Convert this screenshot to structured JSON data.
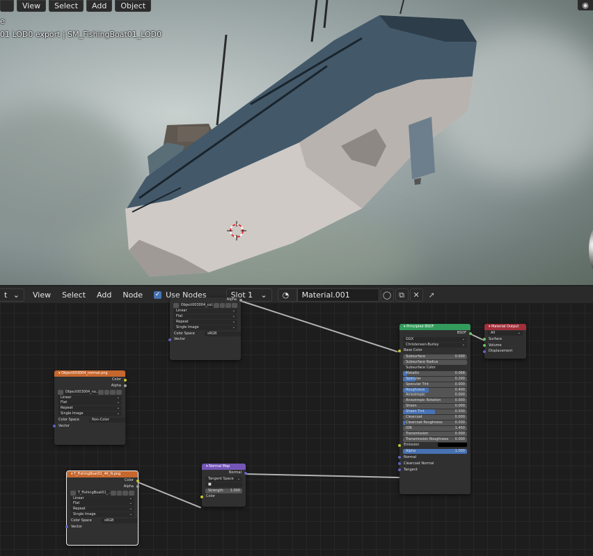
{
  "viewport": {
    "header": {
      "first_label": "",
      "view": "View",
      "select": "Select",
      "add": "Add",
      "object": "Object"
    },
    "mode_label": "e",
    "title": "01 LOD0 export | SM_FishingBoat01_LOD0"
  },
  "node_editor": {
    "header": {
      "type_label": "t",
      "view": "View",
      "select": "Select",
      "add": "Add",
      "node": "Node",
      "use_nodes": "Use Nodes",
      "slot": "Slot 1",
      "material": "Material.001"
    },
    "nodes": {
      "tex_top": {
        "alpha": "Alpha",
        "image": "Object003004_col...",
        "interp": "Linear",
        "proj": "Flat",
        "ext": "Repeat",
        "source": "Single Image",
        "cs_label": "Color Space",
        "cs_value": "sRGB",
        "vector": "Vector"
      },
      "tex_normal": {
        "title": "Object003004_normal.png",
        "color": "Color",
        "alpha": "Alpha",
        "image": "Object003004_no...",
        "interp": "Linear",
        "proj": "Flat",
        "ext": "Repeat",
        "source": "Single Image",
        "cs_label": "Color Space",
        "cs_value": "Non-Color",
        "vector": "Vector"
      },
      "tex_bottom": {
        "title": "T_FishingBoat01_4K_N.png",
        "color": "Color",
        "alpha": "Alpha",
        "image": "T_FishingBoat01_...",
        "interp": "Linear",
        "proj": "Flat",
        "ext": "Repeat",
        "source": "Single Image",
        "cs_label": "Color Space",
        "cs_value": "sRGB",
        "vector": "Vector"
      },
      "normal_map": {
        "title": "Normal Map",
        "normal": "Normal",
        "space": "Tangent Space",
        "uv": "",
        "strength_label": "Strength",
        "strength_value": "1.000",
        "color": "Color"
      },
      "principled": {
        "title": "Principled BSDF",
        "bsdf": "BSDF",
        "distribution": "GGX",
        "subsurface_method": "Christensen-Burley",
        "base_color": "Base Color",
        "params": [
          {
            "label": "Subsurface",
            "value": "0.000",
            "fill": 0
          },
          {
            "label": "Subsurface Radius",
            "value": "",
            "fill": 0
          },
          {
            "label": "Subsurface Color",
            "value": "",
            "fill": 0
          },
          {
            "label": "Metallic",
            "value": "0.068",
            "fill": 0.068
          },
          {
            "label": "Specular",
            "value": "0.200",
            "fill": 0.2
          },
          {
            "label": "Specular Tint",
            "value": "0.000",
            "fill": 0
          },
          {
            "label": "Roughness",
            "value": "0.400",
            "fill": 0.4
          },
          {
            "label": "Anisotropic",
            "value": "0.000",
            "fill": 0
          },
          {
            "label": "Anisotropic Rotation",
            "value": "0.000",
            "fill": 0
          },
          {
            "label": "Sheen",
            "value": "0.000",
            "fill": 0
          },
          {
            "label": "Sheen Tint",
            "value": "0.500",
            "fill": 0.5
          },
          {
            "label": "Clearcoat",
            "value": "0.000",
            "fill": 0
          },
          {
            "label": "Clearcoat Roughness",
            "value": "0.030",
            "fill": 0.03
          },
          {
            "label": "IOR",
            "value": "1.450",
            "fill": 0
          },
          {
            "label": "Transmission",
            "value": "0.000",
            "fill": 0
          },
          {
            "label": "Transmission Roughness",
            "value": "0.000",
            "fill": 0
          }
        ],
        "emission": "Emission",
        "alpha_label": "Alpha",
        "alpha_value": "1.000",
        "normal": "Normal",
        "clearcoat_normal": "Clearcoat Normal",
        "tangent": "Tangent"
      },
      "material_output": {
        "title": "Material Output",
        "target": "All",
        "surface": "Surface",
        "volume": "Volume",
        "displacement": "Displacement"
      }
    }
  },
  "colors": {
    "texture_header": "#c6672e",
    "vector_header": "#7456b8",
    "shader_header": "#339b5b",
    "output_header": "#a2303b",
    "accent_blue": "#4772b3"
  }
}
